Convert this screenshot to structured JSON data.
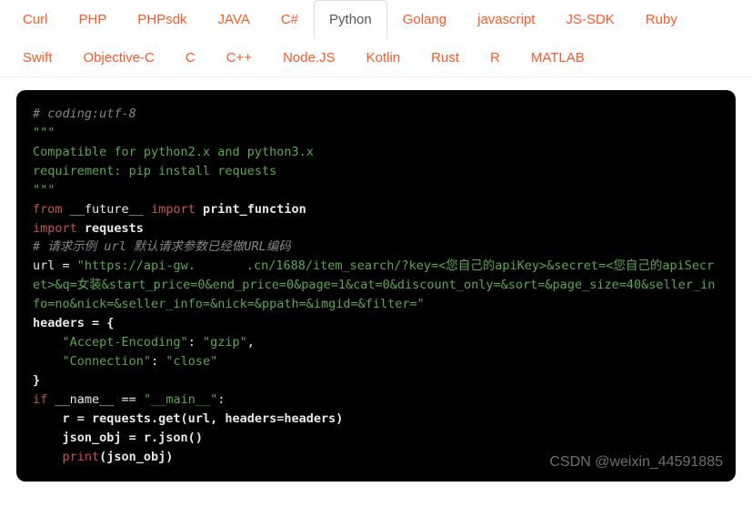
{
  "tabs": {
    "row1": [
      "Curl",
      "PHP",
      "PHPsdk",
      "JAVA",
      "C#",
      "Python",
      "Golang",
      "javascript",
      "JS-SDK",
      "Ruby",
      "Swift"
    ],
    "row2": [
      "Objective-C",
      "C",
      "C++",
      "Node.JS",
      "Kotlin",
      "Rust",
      "R",
      "MATLAB"
    ],
    "active": "Python"
  },
  "code": {
    "l01": "# coding:utf-8",
    "l02": "\"\"\"",
    "l03": "Compatible for python2.x and python3.x",
    "l04": "requirement: pip install requests",
    "l05": "\"\"\"",
    "l06_from": "from",
    "l06_mod": " __future__ ",
    "l06_import": "import",
    "l06_name": " print_function",
    "l07_import": "import",
    "l07_name": " requests",
    "l08": "# 请求示例 url 默认请求参数已经做URL编码",
    "l09_a": "url = ",
    "l09_b": "\"https://api-gw.",
    "l09_c": ".cn/1688/item_search/?key=<您自己的apiKey>&secret=<您自己的apiSecret>&q=女装&start_price=0&end_price=0&page=1&cat=0&discount_only=&sort=&page_size=40&seller_info=no&nick=&seller_info=&nick=&ppath=&imgid=&filter=\"",
    "l10": "headers = {",
    "l11_k": "    \"Accept-Encoding\"",
    "l11_colon": ": ",
    "l11_v": "\"gzip\"",
    "l11_end": ",",
    "l12_k": "    \"Connection\"",
    "l12_colon": ": ",
    "l12_v": "\"close\"",
    "l13": "}",
    "l14_a": "if",
    "l14_b": " __name__ == ",
    "l14_c": "\"__main__\"",
    "l14_d": ":",
    "l15": "    r = requests.get(url, headers=headers)",
    "l16": "    json_obj = r.json()",
    "l17_a": "    ",
    "l17_b": "print",
    "l17_c": "(json_obj)"
  },
  "watermark": "CSDN @weixin_44591885"
}
